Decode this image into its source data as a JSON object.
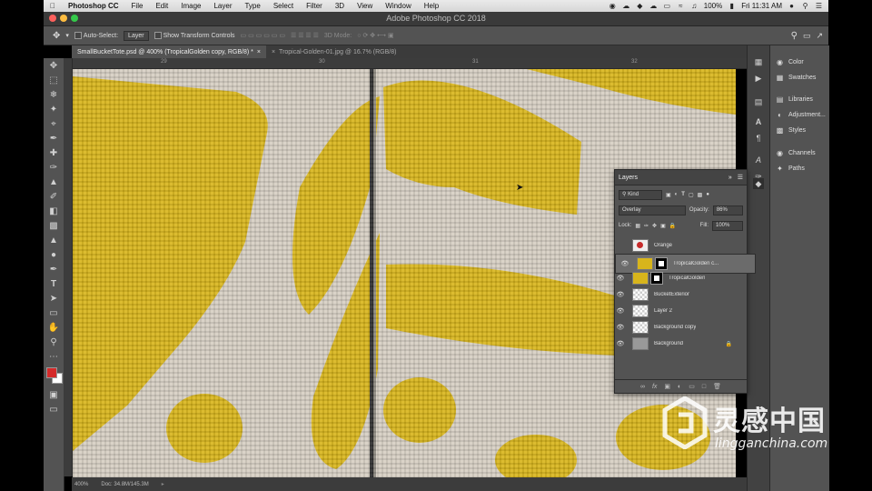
{
  "menubar": {
    "apple": "",
    "app": "Photoshop CC",
    "items": [
      "File",
      "Edit",
      "Image",
      "Layer",
      "Type",
      "Select",
      "Filter",
      "3D",
      "View",
      "Window",
      "Help"
    ],
    "battery": "100%",
    "clock": "Fri 11:31 AM"
  },
  "window": {
    "title": "Adobe Photoshop CC 2018"
  },
  "options": {
    "auto_select_label": "Auto-Select:",
    "auto_select_value": "Layer",
    "transform_label": "Show Transform Controls",
    "mode_3d": "3D Mode:"
  },
  "tabs": [
    {
      "label": "SmallBucketTote.psd @ 400% (TropicalGolden copy, RGB/8) *",
      "close": "×"
    },
    {
      "label": "Tropical-Golden-01.jpg @ 16.7% (RGB/8)",
      "close": "×"
    }
  ],
  "ruler": {
    "ticks": [
      "29",
      "30",
      "31",
      "32"
    ]
  },
  "status": {
    "zoom": "400%",
    "doc": "Doc: 34.8M/145.3M"
  },
  "panels": {
    "items": [
      {
        "label": "Color",
        "icon": "color-wheel-icon"
      },
      {
        "label": "Swatches",
        "icon": "swatches-grid-icon"
      },
      {
        "label": "Libraries",
        "icon": "libraries-icon"
      },
      {
        "label": "Adjustment...",
        "icon": "adjustment-icon"
      },
      {
        "label": "Styles",
        "icon": "styles-icon"
      },
      {
        "label": "Channels",
        "icon": "channels-icon"
      },
      {
        "label": "Paths",
        "icon": "paths-icon"
      }
    ]
  },
  "layers_panel": {
    "title": "Layers",
    "filter": "Kind",
    "blend_mode": "Overlay",
    "opacity_label": "Opacity:",
    "opacity": "86%",
    "lock_label": "Lock:",
    "fill_label": "Fill:",
    "fill": "100%",
    "layers": [
      {
        "name": "Orange",
        "visible": false,
        "mask": false,
        "selected": false,
        "locked": false
      },
      {
        "name": "TropicalGolden c...",
        "visible": true,
        "mask": true,
        "selected": true,
        "locked": false
      },
      {
        "name": "TropicalGolden",
        "visible": true,
        "mask": true,
        "selected": false,
        "locked": false
      },
      {
        "name": "BucketExterior",
        "visible": true,
        "mask": false,
        "selected": false,
        "locked": false
      },
      {
        "name": "Layer 2",
        "visible": true,
        "mask": false,
        "selected": false,
        "locked": false
      },
      {
        "name": "Background copy",
        "visible": true,
        "mask": false,
        "selected": false,
        "locked": false
      },
      {
        "name": "Background",
        "visible": true,
        "mask": false,
        "selected": false,
        "locked": true
      }
    ]
  },
  "colors": {
    "foreground": "#d42a2a",
    "background": "#ffffff",
    "accent_yellow": "#d8b51c"
  },
  "watermark": {
    "brand": "灵感中国",
    "url": "lingganchina.com"
  }
}
